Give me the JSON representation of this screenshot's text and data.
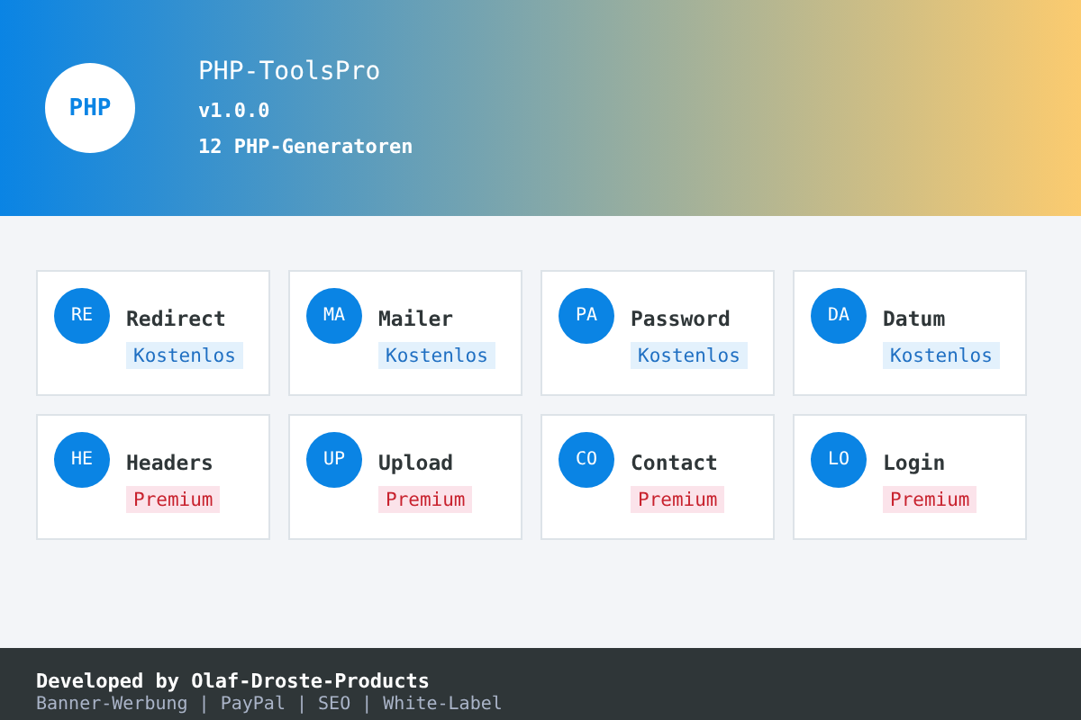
{
  "header": {
    "logo": "PHP",
    "title": "PHP-ToolsPro",
    "version": "v1.0.0",
    "subtitle": "12 PHP-Generatoren"
  },
  "tools": [
    {
      "abbr": "RE",
      "name": "Redirect",
      "tag": "Kostenlos",
      "kind": "free"
    },
    {
      "abbr": "MA",
      "name": "Mailer",
      "tag": "Kostenlos",
      "kind": "free"
    },
    {
      "abbr": "PA",
      "name": "Password",
      "tag": "Kostenlos",
      "kind": "free"
    },
    {
      "abbr": "DA",
      "name": "Datum",
      "tag": "Kostenlos",
      "kind": "free"
    },
    {
      "abbr": "HE",
      "name": "Headers",
      "tag": "Premium",
      "kind": "premium"
    },
    {
      "abbr": "UP",
      "name": "Upload",
      "tag": "Premium",
      "kind": "premium"
    },
    {
      "abbr": "CO",
      "name": "Contact",
      "tag": "Premium",
      "kind": "premium"
    },
    {
      "abbr": "LO",
      "name": "Login",
      "tag": "Premium",
      "kind": "premium"
    }
  ],
  "footer": {
    "credit": "Developed by Olaf-Droste-Products",
    "links": "Banner-Werbung | PayPal | SEO | White-Label"
  }
}
